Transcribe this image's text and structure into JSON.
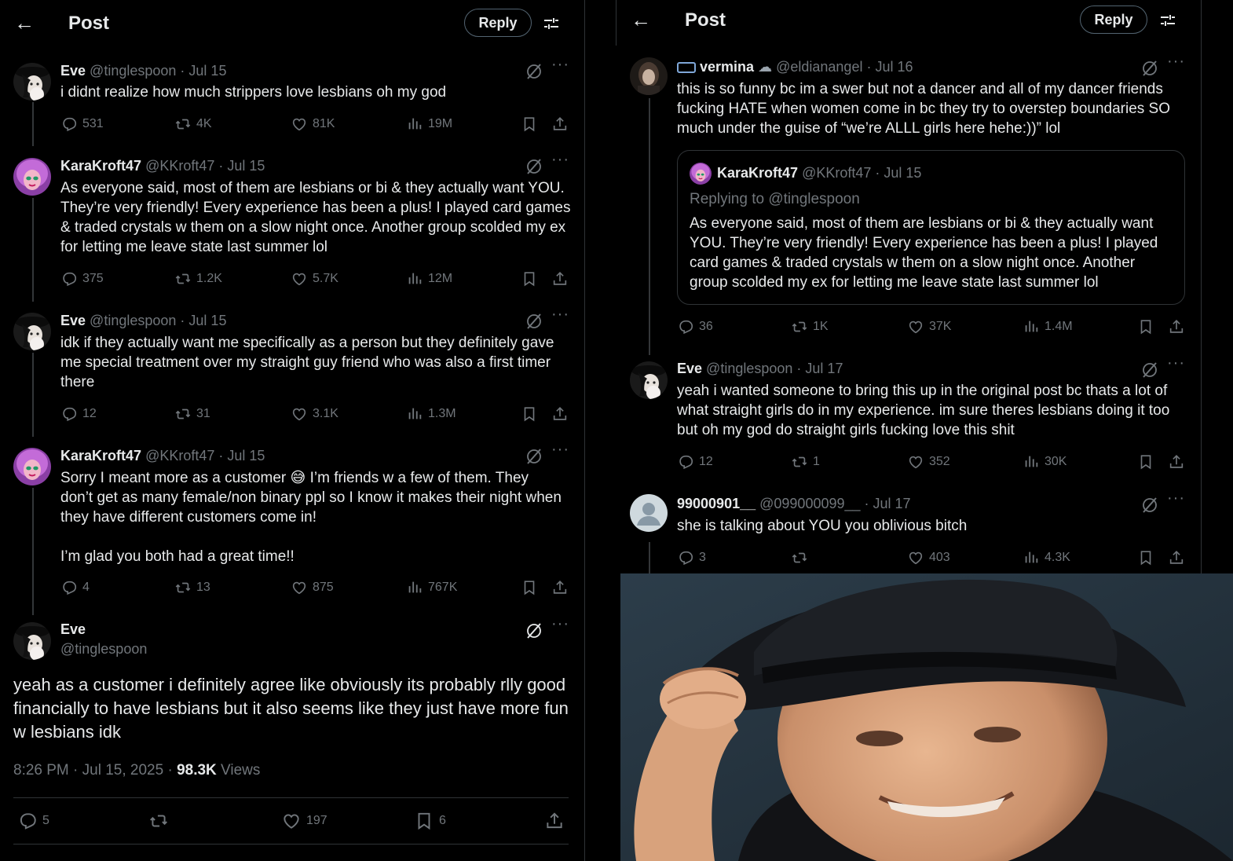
{
  "left": {
    "header": {
      "title": "Post",
      "reply_label": "Reply"
    },
    "tweets": [
      {
        "name": "Eve",
        "handle": "@tinglespoon",
        "date": "· Jul 15",
        "text": "i didnt realize how much strippers love lesbians oh my god",
        "replies": "531",
        "reposts": "4K",
        "likes": "81K",
        "views": "19M"
      },
      {
        "name": "KaraKroft47",
        "handle": "@KKroft47",
        "date": "· Jul 15",
        "text": "As everyone said, most of them are lesbians or bi & they actually want YOU. They’re very friendly! Every experience has been a plus! I played card games & traded crystals w them on a slow night once. Another group scolded my ex for letting me leave state last summer lol",
        "replies": "375",
        "reposts": "1.2K",
        "likes": "5.7K",
        "views": "12M"
      },
      {
        "name": "Eve",
        "handle": "@tinglespoon",
        "date": "· Jul 15",
        "text": "idk if they actually want me specifically as a person but they definitely gave me special treatment over my straight guy friend who was also a first timer there",
        "replies": "12",
        "reposts": "31",
        "likes": "3.1K",
        "views": "1.3M"
      },
      {
        "name": "KaraKroft47",
        "handle": "@KKroft47",
        "date": "· Jul 15",
        "text_1": "Sorry I meant more as a customer",
        "emoji": "😅",
        "text_2": " I’m friends w a few of them. They don’t get as many female/non binary ppl so I know it makes their night when they have different customers come in!",
        "text_3": "I’m glad you both had a great time!!",
        "replies": "4",
        "reposts": "13",
        "likes": "875",
        "views": "767K"
      }
    ],
    "main": {
      "name": "Eve",
      "handle": "@tinglespoon",
      "text": "yeah as a customer i definitely agree like obviously its probably rlly good financially to have lesbians but it also seems like they just have more fun w lesbians idk",
      "timestamp": "8:26 PM · Jul 15, 2025 ·",
      "views": "98.3K",
      "views_label": "Views",
      "replies": "5",
      "likes": "197",
      "bookmarks": "6"
    }
  },
  "right": {
    "header": {
      "title": "Post",
      "reply_label": "Reply"
    },
    "tweets": [
      {
        "name": "vermina",
        "handle": "@eldianangel",
        "date": "· Jul 16",
        "text": "this is so funny bc im a swer but not a dancer and all of my dancer friends fucking HATE when women come in bc they try to overstep boundaries SO much under the guise of “we’re ALLL girls here hehe:))” lol",
        "quote": {
          "name": "KaraKroft47",
          "handle": "@KKroft47",
          "date": "· Jul 15",
          "replying": "Replying to @tinglespoon",
          "text": "As everyone said, most of them are lesbians or bi & they actually want YOU. They’re very friendly! Every experience has been a plus! I played card games & traded crystals w them on a slow night once. Another group scolded my ex for letting me leave state last summer lol"
        },
        "replies": "36",
        "reposts": "1K",
        "likes": "37K",
        "views": "1.4M"
      },
      {
        "name": "Eve",
        "handle": "@tinglespoon",
        "date": "· Jul 17",
        "text": "yeah i wanted someone to bring this up in the original post bc thats a lot of what straight girls do in my experience. im sure theres lesbians doing it too but oh my god do straight girls fucking love this shit",
        "replies": "12",
        "reposts": "1",
        "likes": "352",
        "views": "30K"
      },
      {
        "name": "99000901__",
        "handle": "@099000099__",
        "date": "· Jul 17",
        "text": "she is talking about YOU you oblivious bitch",
        "replies": "3",
        "reposts": "",
        "likes": "403",
        "views": "4.3K"
      }
    ]
  },
  "colors": {
    "background": "#000000",
    "text": "#e7e9ea",
    "muted": "#71767b",
    "border": "#2f3336"
  }
}
